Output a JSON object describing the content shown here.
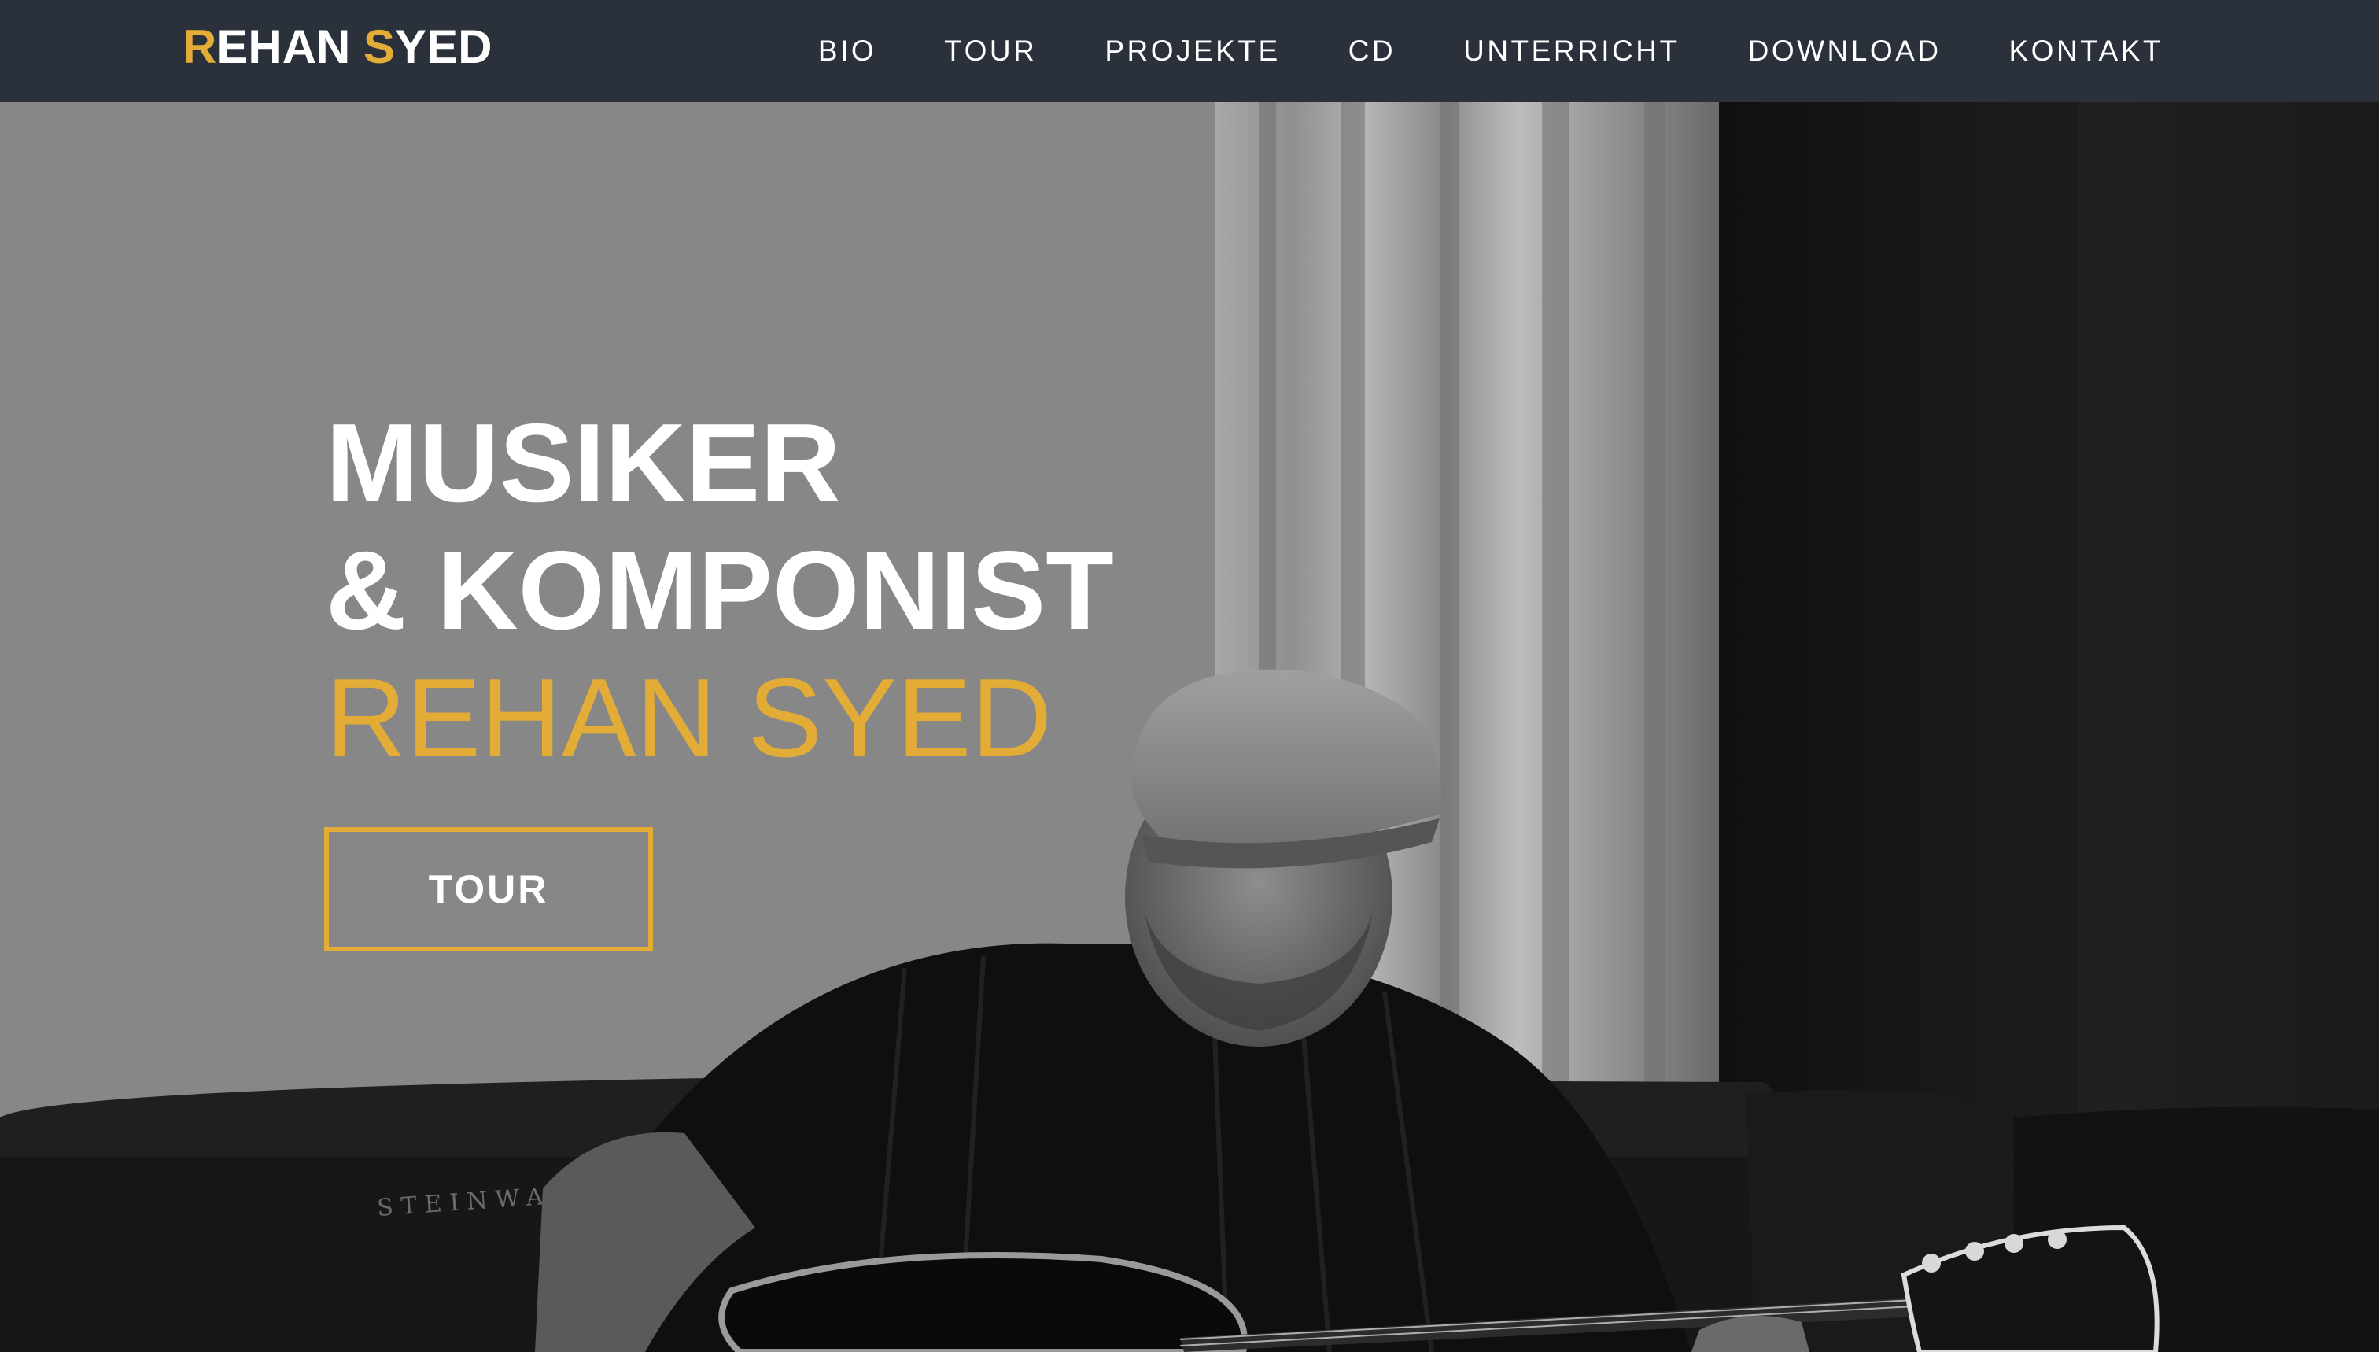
{
  "brand": {
    "first_initial": "R",
    "first_rest": "EHAN ",
    "second_initial": "S",
    "second_rest": "YED"
  },
  "nav": {
    "items": [
      {
        "label": "BIO"
      },
      {
        "label": "TOUR"
      },
      {
        "label": "PROJEKTE"
      },
      {
        "label": "CD"
      },
      {
        "label": "UNTERRICHT"
      },
      {
        "label": "DOWNLOAD"
      },
      {
        "label": "KONTAKT"
      }
    ]
  },
  "hero": {
    "line1": "MUSIKER",
    "line2": "& KOMPONIST",
    "name": "REHAN SYED",
    "cta_label": "TOUR",
    "image_subject": "black-and-white photo of guitarist in flat cap playing electric guitar on a sofa"
  },
  "colors": {
    "accent": "#e2ac36",
    "navbar_bg": "#2b313b",
    "text": "#ffffff"
  }
}
